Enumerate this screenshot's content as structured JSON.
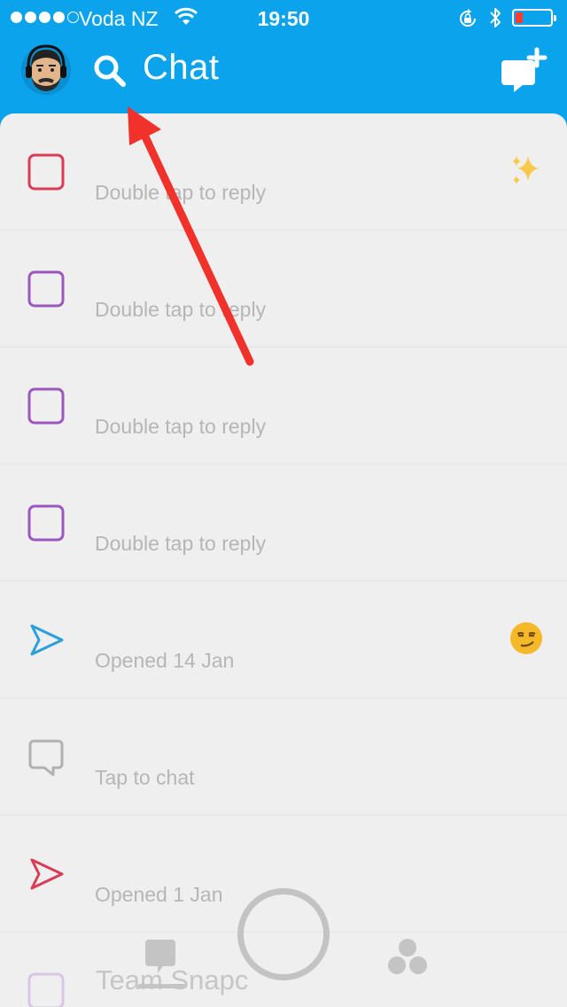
{
  "status_bar": {
    "carrier": "Voda NZ",
    "time": "19:50",
    "signal_bars_filled": 4,
    "signal_bars_total": 5,
    "battery_level": 0.2,
    "icons": [
      "signal-icon",
      "wifi-icon",
      "orientation-lock-icon",
      "bluetooth-icon",
      "battery-icon"
    ]
  },
  "header": {
    "title": "Chat",
    "avatar": "bitmoji-avatar",
    "icons": [
      "search-icon",
      "new-chat-icon"
    ]
  },
  "chats": [
    {
      "name": "",
      "status": "Double tap to reply",
      "icon": "unread-snap-square-icon",
      "icon_color": "#d93d55",
      "emoji": "sparkles-emoji"
    },
    {
      "name": "",
      "status": "Double tap to reply",
      "icon": "unread-snap-square-icon",
      "icon_color": "#9a58c0",
      "emoji": ""
    },
    {
      "name": "",
      "status": "Double tap to reply",
      "icon": "unread-snap-square-icon",
      "icon_color": "#9a58c0",
      "emoji": ""
    },
    {
      "name": "",
      "status": "Double tap to reply",
      "icon": "unread-snap-square-icon",
      "icon_color": "#9a58c0",
      "emoji": ""
    },
    {
      "name": "",
      "status": "Opened 14 Jan",
      "icon": "sent-arrow-icon",
      "icon_color": "#2b9fd9",
      "emoji": "smirking-face-emoji"
    },
    {
      "name": "",
      "status": "Tap to chat",
      "icon": "chat-bubble-icon",
      "icon_color": "#b1b1b1",
      "emoji": ""
    },
    {
      "name": "",
      "status": "Opened 1 Jan",
      "icon": "sent-arrow-icon",
      "icon_color": "#d93d55",
      "emoji": ""
    },
    {
      "name": "Team Snapc",
      "status": "",
      "icon": "unread-snap-square-icon",
      "icon_color": "#d7c4e6",
      "emoji": ""
    }
  ],
  "bottom_nav": {
    "icons": [
      "chat-tab-icon",
      "capture-button",
      "stories-tab-icon"
    ]
  },
  "annotation": {
    "type": "red-arrow",
    "color": "#f0322b"
  },
  "colors": {
    "header_blue": "#0aa3ec",
    "list_background": "#efefef",
    "secondary_text": "#b6b6b6"
  }
}
